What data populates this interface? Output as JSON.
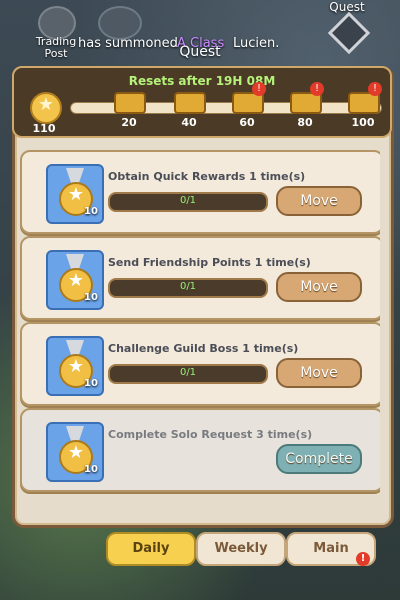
{
  "header": {
    "trading_post_label": "Trading Post",
    "quest_label": "Quest",
    "summon_text_prefix": "has summoned",
    "summon_class": "A Class",
    "summon_suffix": "Lucien."
  },
  "panel": {
    "title": "Quest",
    "resets_text": "Resets after 19H 08M",
    "current_points": "110",
    "milestones": [
      {
        "value": "20",
        "alert": false
      },
      {
        "value": "40",
        "alert": false
      },
      {
        "value": "60",
        "alert": true
      },
      {
        "value": "80",
        "alert": true
      },
      {
        "value": "100",
        "alert": true
      }
    ]
  },
  "quests": [
    {
      "title": "Obtain Quick Rewards 1 time(s)",
      "progress": "0/1",
      "reward": "10",
      "action": "Move",
      "state": "move"
    },
    {
      "title": "Send Friendship Points 1 time(s)",
      "progress": "0/1",
      "reward": "10",
      "action": "Move",
      "state": "move"
    },
    {
      "title": "Challenge Guild Boss 1 time(s)",
      "progress": "0/1",
      "reward": "10",
      "action": "Move",
      "state": "move"
    },
    {
      "title": "Complete Solo Request 3 time(s)",
      "progress": "",
      "reward": "10",
      "action": "Complete",
      "state": "complete"
    }
  ],
  "tabs": {
    "daily": "Daily",
    "weekly": "Weekly",
    "main": "Main"
  },
  "colors": {
    "accent": "#f7d04f",
    "progress_text": "#99f07a",
    "alert": "#e23b2a"
  }
}
